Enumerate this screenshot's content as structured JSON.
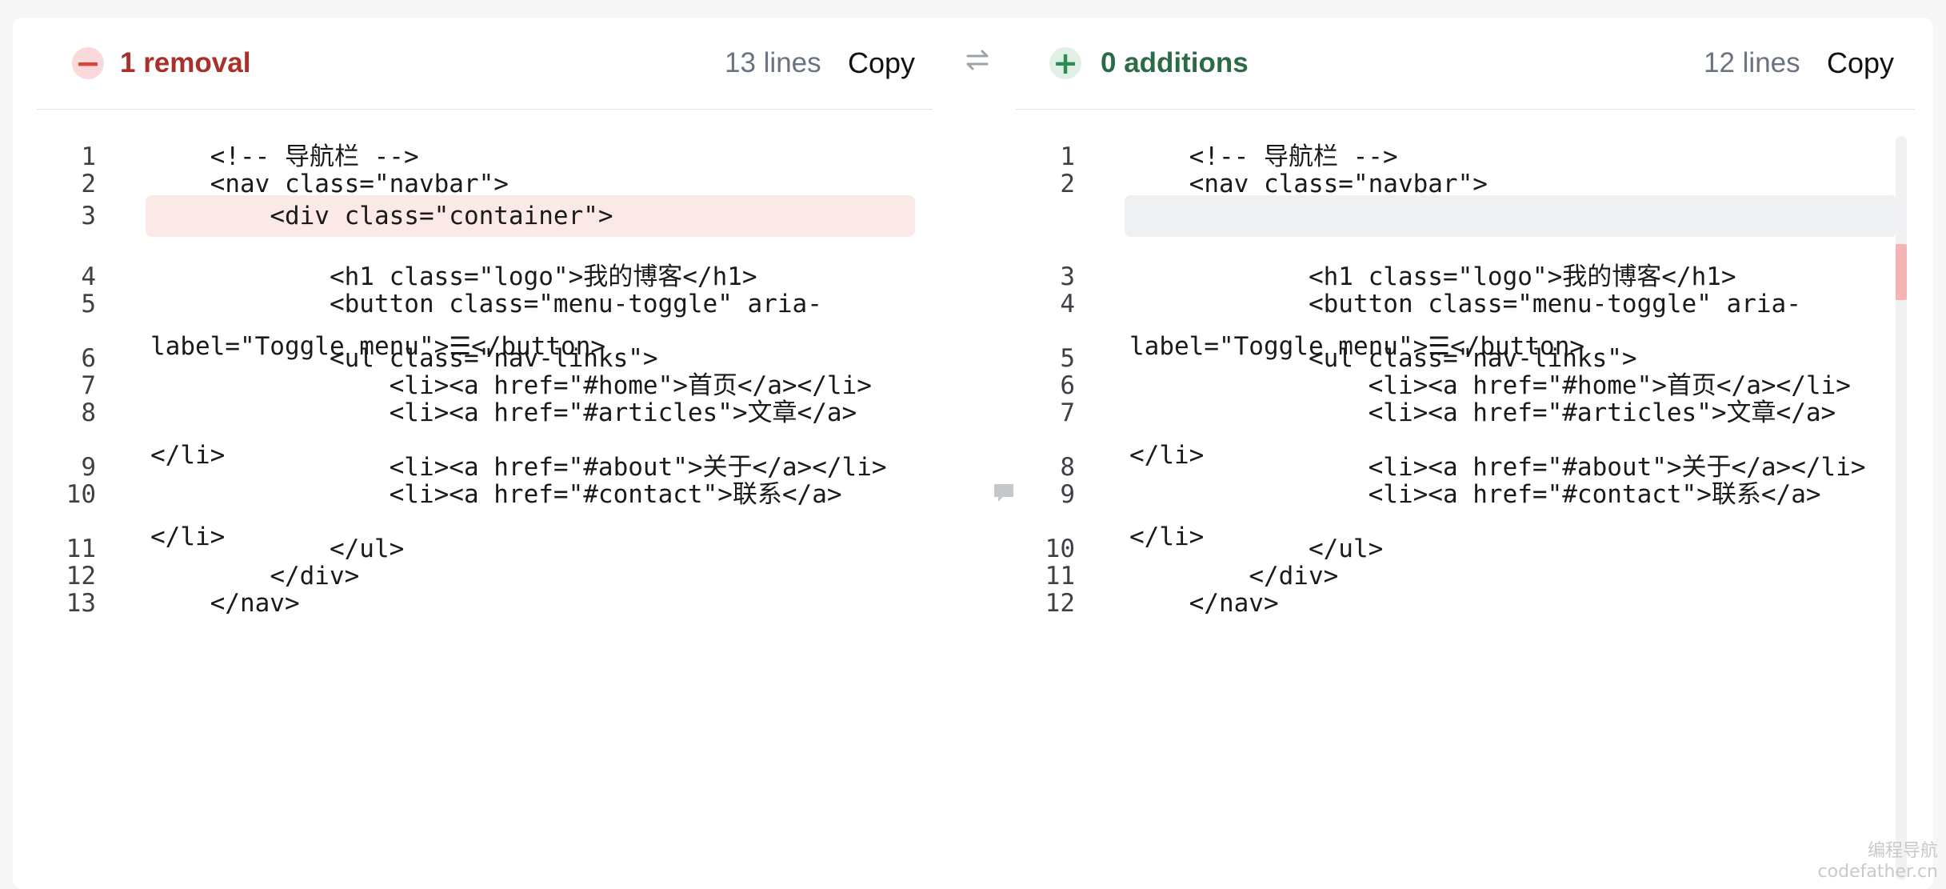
{
  "left_panel": {
    "stat": "1 removal",
    "lines_count": "13 lines",
    "copy_label": "Copy",
    "badge_symbol": "−",
    "rows": [
      {
        "ln": "1",
        "text": "    <!-- 导航栏 -->",
        "state": "normal",
        "wrap": 1
      },
      {
        "ln": "2",
        "text": "    <nav class=\"navbar\">",
        "state": "normal",
        "wrap": 1
      },
      {
        "ln": "3",
        "text": "        <div class=\"container\">",
        "state": "removed",
        "wrap": 1
      },
      {
        "ln": "4",
        "text": "            <h1 class=\"logo\">我的博客</h1>",
        "state": "normal",
        "wrap": 1
      },
      {
        "ln": "5",
        "text": "            <button class=\"menu-toggle\" aria-\nlabel=\"Toggle menu\">☰</button>",
        "state": "normal",
        "wrap": 2
      },
      {
        "ln": "6",
        "text": "            <ul class=\"nav-links\">",
        "state": "normal",
        "wrap": 1
      },
      {
        "ln": "7",
        "text": "                <li><a href=\"#home\">首页</a></li>",
        "state": "normal",
        "wrap": 1
      },
      {
        "ln": "8",
        "text": "                <li><a href=\"#articles\">文章</a>\n</li>",
        "state": "normal",
        "wrap": 2
      },
      {
        "ln": "9",
        "text": "                <li><a href=\"#about\">关于</a></li>",
        "state": "normal",
        "wrap": 1
      },
      {
        "ln": "10",
        "text": "                <li><a href=\"#contact\">联系</a>\n</li>",
        "state": "normal",
        "wrap": 2
      },
      {
        "ln": "11",
        "text": "            </ul>",
        "state": "normal",
        "wrap": 1
      },
      {
        "ln": "12",
        "text": "        </div>",
        "state": "normal",
        "wrap": 1
      },
      {
        "ln": "13",
        "text": "    </nav>",
        "state": "normal",
        "wrap": 1
      }
    ]
  },
  "right_panel": {
    "stat": "0 additions",
    "lines_count": "12 lines",
    "copy_label": "Copy",
    "badge_symbol": "+",
    "rows": [
      {
        "ln": "1",
        "text": "    <!-- 导航栏 -->",
        "state": "normal",
        "wrap": 1
      },
      {
        "ln": "2",
        "text": "    <nav class=\"navbar\">",
        "state": "normal",
        "wrap": 1
      },
      {
        "ln": "",
        "text": "",
        "state": "empty",
        "wrap": 1
      },
      {
        "ln": "3",
        "text": "            <h1 class=\"logo\">我的博客</h1>",
        "state": "normal",
        "wrap": 1
      },
      {
        "ln": "4",
        "text": "            <button class=\"menu-toggle\" aria-\nlabel=\"Toggle menu\">☰</button>",
        "state": "normal",
        "wrap": 2
      },
      {
        "ln": "5",
        "text": "            <ul class=\"nav-links\">",
        "state": "normal",
        "wrap": 1
      },
      {
        "ln": "6",
        "text": "                <li><a href=\"#home\">首页</a></li>",
        "state": "normal",
        "wrap": 1
      },
      {
        "ln": "7",
        "text": "                <li><a href=\"#articles\">文章</a>\n</li>",
        "state": "normal",
        "wrap": 2
      },
      {
        "ln": "8",
        "text": "                <li><a href=\"#about\">关于</a></li>",
        "state": "normal",
        "wrap": 1
      },
      {
        "ln": "9",
        "text": "                <li><a href=\"#contact\">联系</a>\n</li>",
        "state": "normal",
        "wrap": 2
      },
      {
        "ln": "10",
        "text": "            </ul>",
        "state": "normal",
        "wrap": 1
      },
      {
        "ln": "11",
        "text": "        </div>",
        "state": "normal",
        "wrap": 1
      },
      {
        "ln": "12",
        "text": "    </nav>",
        "state": "normal",
        "wrap": 1
      }
    ]
  },
  "icons": {
    "swap": "swap-arrows-icon",
    "comment": "comment-icon"
  },
  "colors": {
    "removed_bg": "#fbe9e8",
    "removed_text": "#a8312b",
    "added_text": "#2c6b45",
    "empty_bg": "#eff0f2"
  },
  "watermark": {
    "line1": "编程导航",
    "line2": "codefather.cn"
  }
}
